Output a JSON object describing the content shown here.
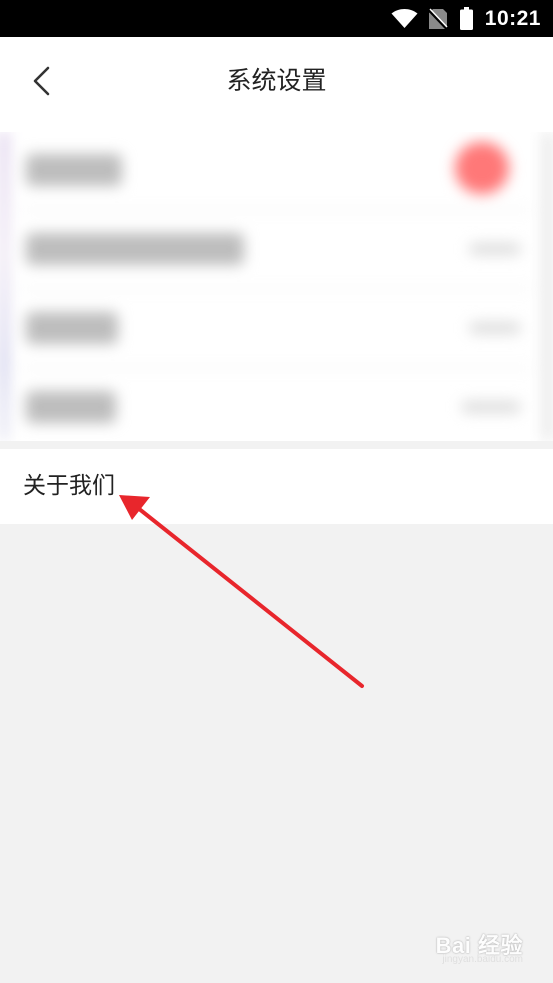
{
  "status_bar": {
    "time": "10:21",
    "icons": [
      "wifi-icon",
      "no-sim-icon",
      "battery-icon"
    ]
  },
  "header": {
    "back_icon": "chevron-left-icon",
    "title": "系统设置"
  },
  "menu": {
    "about_label": "关于我们"
  },
  "watermark": {
    "main": "Bai 经验",
    "url": "jingyan.baidu.com"
  },
  "colors": {
    "status_bar_bg": "#000000",
    "page_bg": "#f2f2f2",
    "row_bg": "#ffffff",
    "text_primary": "#222222",
    "annotation_arrow": "#e8262c",
    "blurred_badge": "#ff7878"
  }
}
